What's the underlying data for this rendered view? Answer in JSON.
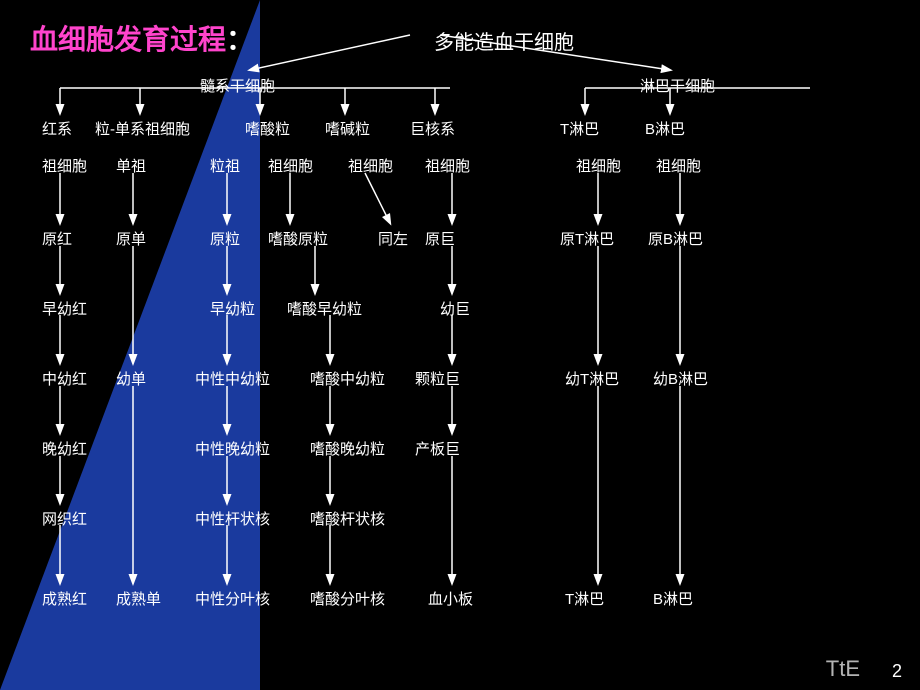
{
  "title": {
    "main": "血细胞发育过程",
    "colon": "：",
    "sub": "多能造血干细胞"
  },
  "nodes": {
    "multipotent": "多能造血干细胞",
    "myeloid_stem": "髓系干细胞",
    "lymphoid_stem": "淋巴干细胞",
    "erythroid_line": "红系",
    "granulocyte_line": "粒-单系祖细胞",
    "eosinophil_line": "嗜酸粒",
    "basophil_line": "嗜碱粒",
    "megakaryocyte_line": "巨核系",
    "t_lymph": "T淋巴",
    "b_lymph": "B淋巴",
    "erythroid_prog": "祖细胞",
    "mono_prog": "单祖",
    "gran_prog": "粒祖",
    "eos_prog": "祖细胞",
    "baso_prog": "祖细胞",
    "mega_prog": "祖细胞",
    "t_prog": "祖细胞",
    "b_prog": "祖细胞",
    "pro_eryth": "原红",
    "pro_mono": "原单",
    "pro_gran": "原粒",
    "pro_eos": "嗜酸原粒",
    "pro_same": "同左",
    "pro_mega": "原巨",
    "pro_t": "原T淋巴",
    "pro_b": "原B淋巴",
    "early_eryth": "早幼红",
    "early_gran": "早幼粒",
    "early_eos": "嗜酸早幼粒",
    "early_mega": "幼巨",
    "mid_eryth": "中幼红",
    "young_mono": "幼单",
    "mid_gran": "中性中幼粒",
    "mid_eos": "嗜酸中幼粒",
    "gran_mega": "颗粒巨",
    "young_t": "幼T淋巴",
    "young_b": "幼B淋巴",
    "late_eryth": "晚幼红",
    "late_gran": "中性晚幼粒",
    "late_eos": "嗜酸晚幼粒",
    "plate_mega": "产板巨",
    "retic": "网织红",
    "band_gran": "中性杆状核",
    "band_eos": "嗜酸杆状核",
    "mature_eryth": "成熟红",
    "mature_mono": "成熟单",
    "seg_gran": "中性分叶核",
    "seg_eos": "嗜酸分叶核",
    "platelet": "血小板",
    "t_lymph_mature": "T淋巴",
    "b_lymph_mature": "B淋巴"
  },
  "page_num": "2",
  "watermark": "TtE"
}
